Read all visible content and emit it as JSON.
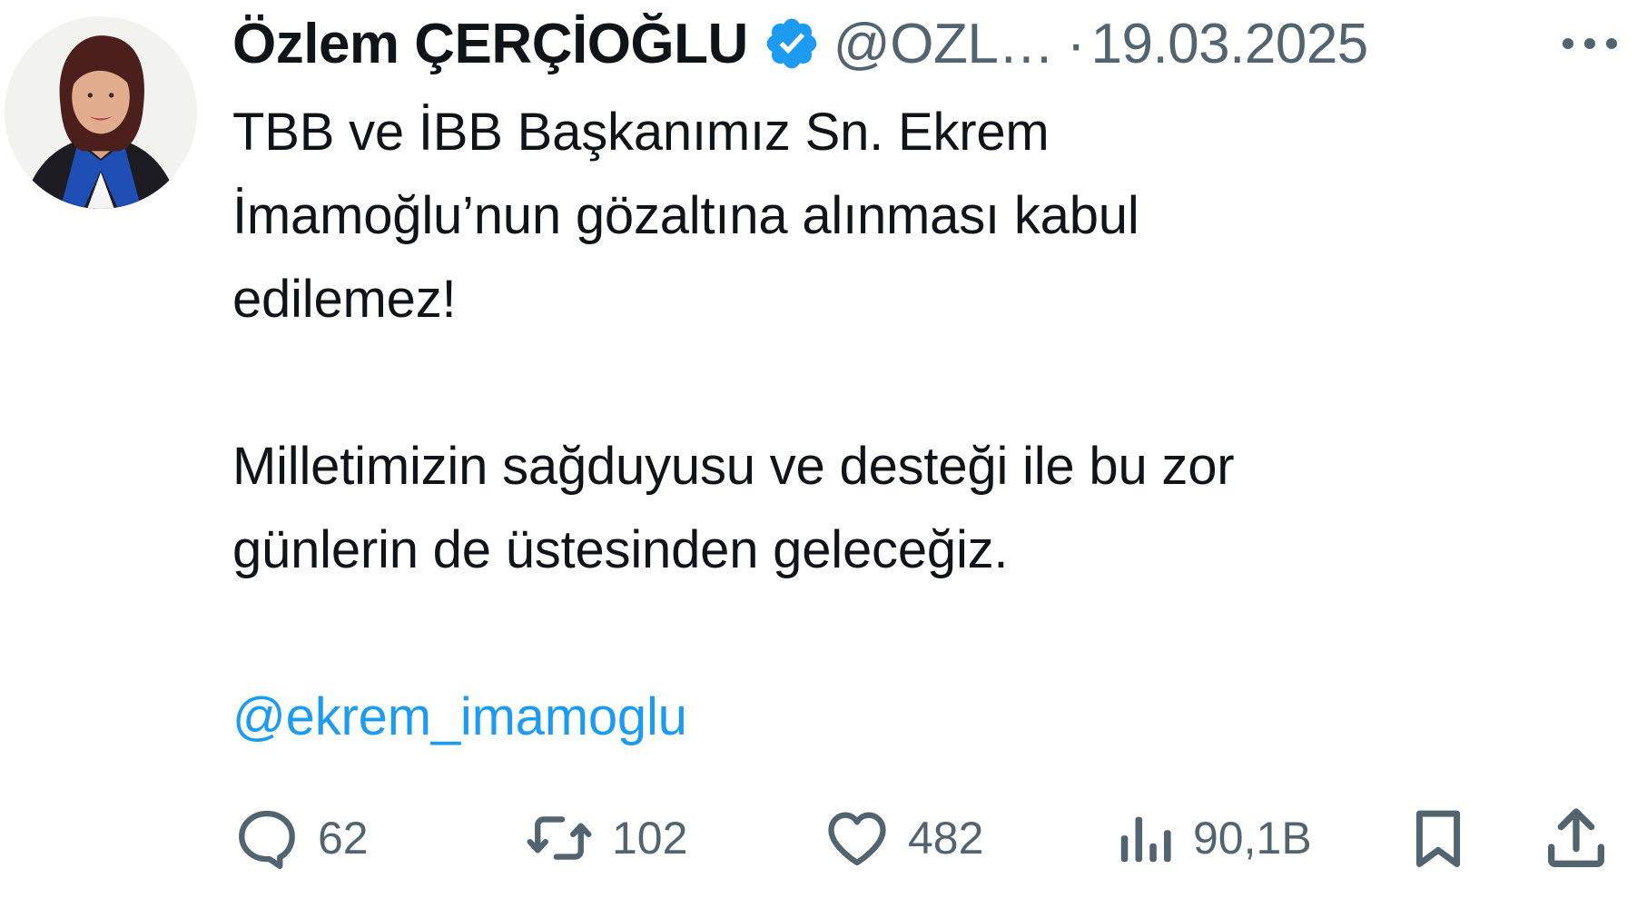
{
  "tweet": {
    "author": {
      "name": "Özlem ÇERÇİOĞLU",
      "handle": "@OZL…",
      "separator": "·",
      "date": "19.03.2025"
    },
    "icons": {
      "verified": "verified-badge-icon",
      "more": "more-options-icon",
      "reply": "reply-icon",
      "retweet": "retweet-icon",
      "like": "like-icon",
      "views": "views-icon",
      "bookmark": "bookmark-icon",
      "share": "share-icon"
    },
    "text": {
      "line1": "TBB ve İBB Başkanımız Sn. Ekrem",
      "line2": "İmamoğlu’nun gözaltına alınması kabul",
      "line3": "edilemez!",
      "line4": "Milletimizin sağduyusu ve desteği ile bu zor",
      "line5": "günlerin de üstesinden geleceğiz.",
      "mention": "@ekrem_imamoglu"
    },
    "stats": {
      "replies": "62",
      "retweets": "102",
      "likes": "482",
      "views": "90,1B"
    },
    "colors": {
      "text": "#0f1419",
      "muted": "#536471",
      "link": "#1d9bf0",
      "verified": "#1d9bf0"
    }
  }
}
